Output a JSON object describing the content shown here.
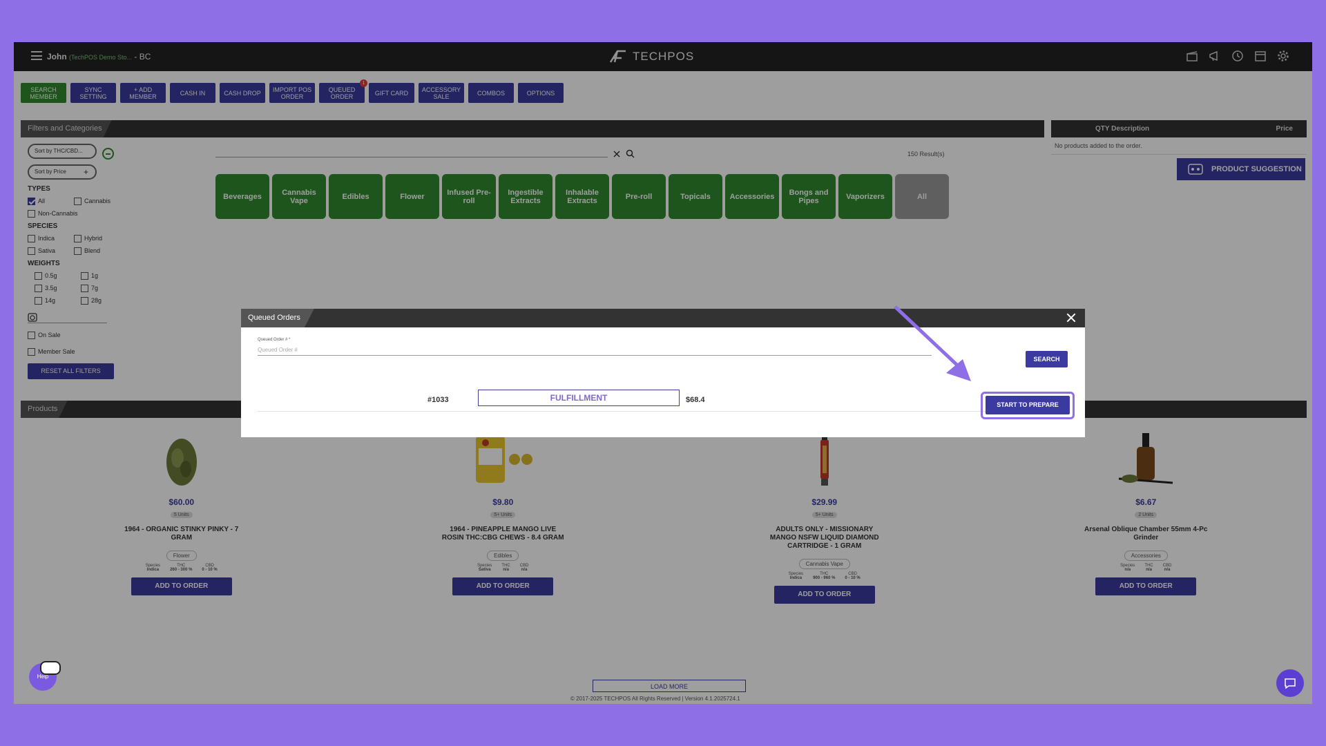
{
  "topbar": {
    "user": "John",
    "store": "(TechPOS Demo Sto...",
    "region": "- BC",
    "logo": "TECHPOS"
  },
  "toolbar": [
    {
      "label": "SEARCH MEMBER",
      "color": "green"
    },
    {
      "label": "SYNC SETTING"
    },
    {
      "label": "+ ADD MEMBER"
    },
    {
      "label": "CASH IN"
    },
    {
      "label": "CASH DROP"
    },
    {
      "label": "IMPORT POS ORDER"
    },
    {
      "label": "QUEUED ORDER",
      "badge": "1"
    },
    {
      "label": "GIFT CARD"
    },
    {
      "label": "ACCESSORY SALE"
    },
    {
      "label": "COMBOS"
    },
    {
      "label": "OPTIONS"
    }
  ],
  "filters": {
    "title": "Filters and Categories",
    "sort_thc": "Sort by THC/CBD...",
    "sort_price": "Sort by Price",
    "types_label": "TYPES",
    "types": [
      "All",
      "Cannabis",
      "Non-Cannabis"
    ],
    "species_label": "SPECIES",
    "species": [
      "Indica",
      "Hybrid",
      "Sativa",
      "Blend"
    ],
    "weights_label": "WEIGHTS",
    "weights": [
      "0.5g",
      "1g",
      "3.5g",
      "7g",
      "14g",
      "28g"
    ],
    "on_sale": "On Sale",
    "member_sale": "Member Sale",
    "reset": "RESET ALL FILTERS",
    "results": "150 Result(s)"
  },
  "categories": [
    "Beverages",
    "Cannabis Vape",
    "Edibles",
    "Flower",
    "Infused Pre-roll",
    "Ingestible Extracts",
    "Inhalable Extracts",
    "Pre-roll",
    "Topicals",
    "Accessories",
    "Bongs and Pipes",
    "Vaporizers",
    "All"
  ],
  "order_panel": {
    "qty_desc": "QTY Description",
    "price": "Price",
    "empty": "No products added to the order.",
    "suggestion": "PRODUCT SUGGESTION"
  },
  "products_title": "Products",
  "products": [
    {
      "price": "$60.00",
      "units": "5 Units",
      "name": "1964 - ORGANIC STINKY PINKY - 7 GRAM",
      "tag": "Flower",
      "species": "Indica",
      "thc": "260 - 300 %",
      "cbd": "0 - 10 %",
      "add": "ADD TO ORDER"
    },
    {
      "price": "$9.80",
      "units": "5+ Units",
      "name": "1964 - PINEAPPLE MANGO LIVE ROSIN THC:CBG CHEWS - 8.4 GRAM",
      "tag": "Edibles",
      "species": "Sativa",
      "thc": "n/a",
      "cbd": "n/a",
      "add": "ADD TO ORDER"
    },
    {
      "price": "$29.99",
      "units": "5+ Units",
      "name": "ADULTS ONLY - MISSIONARY MANGO NSFW LIQUID DIAMOND CARTRIDGE - 1 GRAM",
      "tag": "Cannabis Vape",
      "species": "Indica",
      "thc": "900 - 960 %",
      "cbd": "0 - 10 %",
      "add": "ADD TO ORDER"
    },
    {
      "price": "$6.67",
      "units": "2 Units",
      "name": "Arsenal Oblique Chamber 55mm 4-Pc Grinder",
      "tag": "Accessories",
      "species": "n/a",
      "thc": "n/a",
      "cbd": "n/a",
      "add": "ADD TO ORDER"
    }
  ],
  "meta_labels": {
    "species": "Species",
    "thc": "THC",
    "cbd": "CBD"
  },
  "load_more": "LOAD MORE",
  "footer": "© 2017-2025 TECHPOS All Rights Reserved | Version 4.1.2025724.1",
  "help": "Help",
  "modal": {
    "title": "Queued Orders",
    "field_label": "Queued Order # *",
    "placeholder": "Queued Order #",
    "search": "SEARCH",
    "order": {
      "number": "#1033",
      "status": "FULFILLMENT",
      "total": "$68.4",
      "action": "START TO PREPARE"
    }
  },
  "colors": {
    "accent": "#3b3aa0",
    "green": "#2f8a2f",
    "highlight": "#8e6fe6"
  }
}
